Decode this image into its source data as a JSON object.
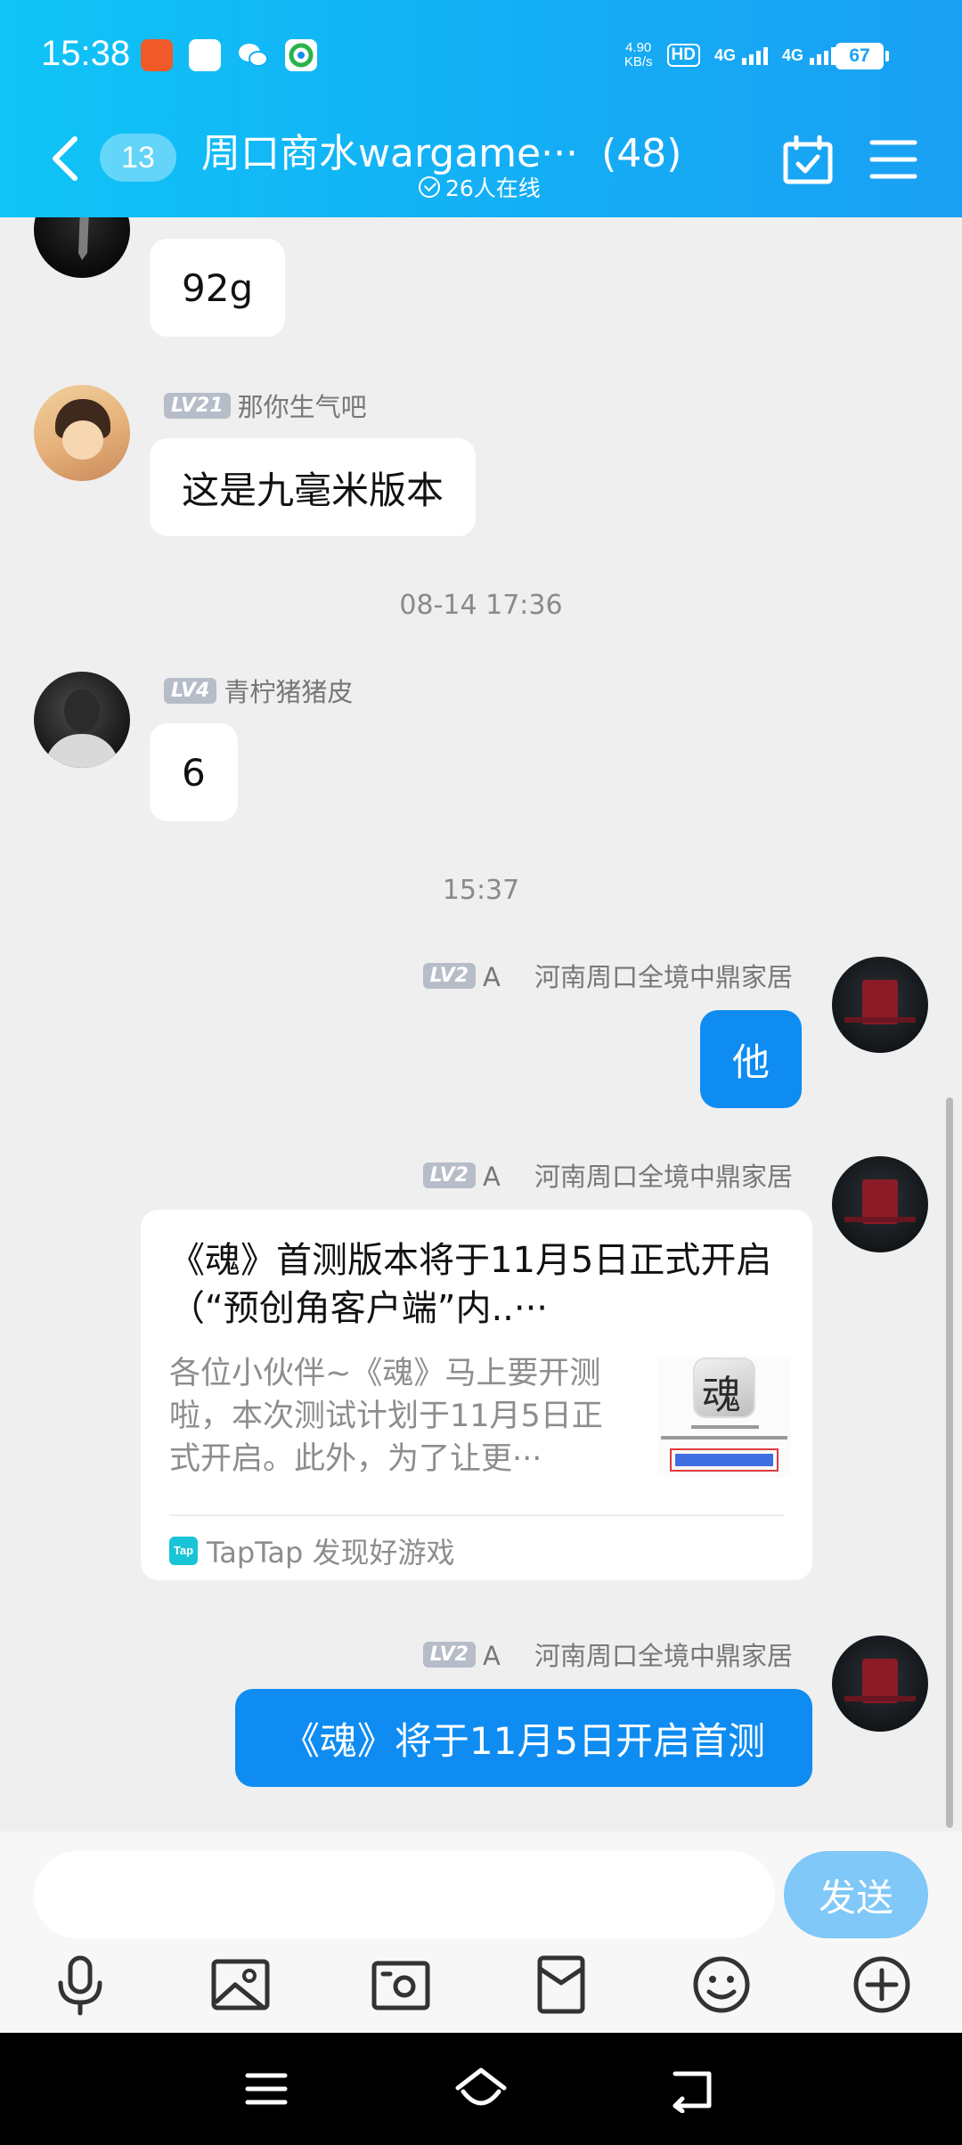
{
  "status_bar": {
    "time": "15:38",
    "net_speed_value": "4.90",
    "net_speed_unit": "KB/s",
    "hd_label": "HD",
    "sim1_label": "4G",
    "sim2_label": "4G",
    "battery": "67"
  },
  "header": {
    "unread_count": "13",
    "group_title": "周口商水wargame···",
    "member_count": "(48)",
    "online_text": "26人在线"
  },
  "messages": {
    "m1": {
      "text": "92g"
    },
    "m2": {
      "level": "LV21",
      "sender": "那你生气吧",
      "text": "这是九毫米版本"
    },
    "time1": "08-14 17:36",
    "m3": {
      "level": "LV4",
      "sender": "青柠猪猪皮",
      "text": "6"
    },
    "time2": "15:37",
    "m4": {
      "level": "LV2",
      "sender": "A　 河南周口全境中鼎家居",
      "text": "他"
    },
    "m5": {
      "level": "LV2",
      "sender": "A　 河南周口全境中鼎家居",
      "card_title": "《魂》首测版本将于11月5日正式开启（“预创角客户端”内..···",
      "card_desc": "各位小伙伴~《魂》马上要开测啦，本次测试计划于11月5日正式开启。此外，为了让更···",
      "card_source": "TapTap 发现好游戏",
      "tap_icon_label": "Tap"
    },
    "m6": {
      "level": "LV2",
      "sender": "A　 河南周口全境中鼎家居",
      "text": "《魂》将于11月5日开启首测"
    }
  },
  "composer": {
    "input_value": "",
    "send_label": "发送"
  },
  "colors": {
    "header_gradient_start": "#0fc4f6",
    "header_gradient_end": "#1aa0f3",
    "my_bubble": "#0e8cf1",
    "send_button": "#7fc8f8",
    "chat_background": "#efefef"
  }
}
